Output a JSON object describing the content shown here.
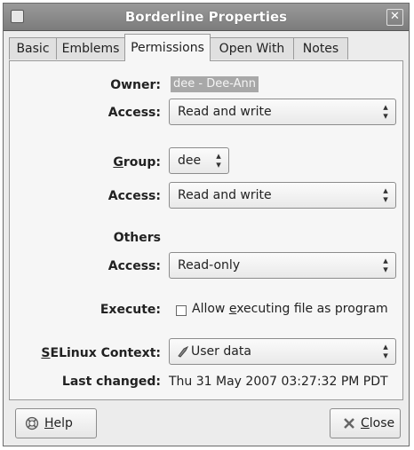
{
  "window": {
    "title": "Borderline Properties",
    "close_glyph": "✕",
    "menu_icon": "window-menu-icon"
  },
  "tabs": [
    {
      "label": "Basic",
      "active": false
    },
    {
      "label": "Emblems",
      "active": false
    },
    {
      "label": "Permissions",
      "active": true
    },
    {
      "label": "Open With",
      "active": false
    },
    {
      "label": "Notes",
      "active": false
    }
  ],
  "permissions": {
    "owner_label": "Owner:",
    "owner_value": "dee - Dee-Ann",
    "owner_access_label": "Access:",
    "owner_access_value": "Read and write",
    "group_label_underlined": "G",
    "group_label_rest": "roup:",
    "group_value": "dee",
    "group_access_label": "Access:",
    "group_access_value": "Read and write",
    "others_label": "Others",
    "others_access_label": "Access:",
    "others_access_value": "Read-only",
    "execute_label": "Execute:",
    "execute_checked": false,
    "execute_text_pre": "Allow ",
    "execute_text_underlined": "e",
    "execute_text_post": "xecuting file as program",
    "selinux_label_underlined": "S",
    "selinux_label_rest": "ELinux Context:",
    "selinux_value": "User data",
    "selinux_icon": "shield-icon",
    "last_changed_label": "Last changed:",
    "last_changed_value": "Thu 31 May 2007 03:27:32 PM PDT"
  },
  "buttons": {
    "help_underlined": "H",
    "help_rest": "elp",
    "help_icon": "help-lifebuoy-icon",
    "close_underlined": "C",
    "close_rest": "lose",
    "close_icon": "close-x-icon"
  }
}
